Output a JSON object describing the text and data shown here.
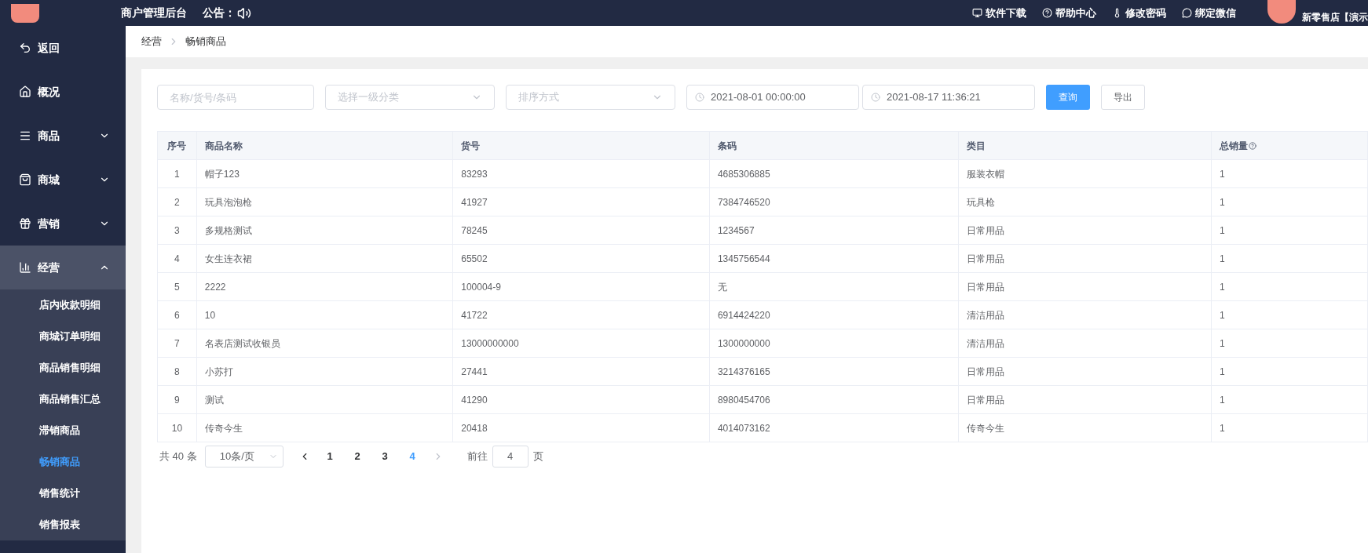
{
  "header": {
    "title": "商户管理后台",
    "notice_label": "公告：",
    "links": [
      {
        "kind": "download",
        "label": "软件下载"
      },
      {
        "kind": "help",
        "label": "帮助中心"
      },
      {
        "kind": "password",
        "label": "修改密码"
      },
      {
        "kind": "wechat",
        "label": "绑定微信"
      }
    ],
    "store_name": "新零售店【演示"
  },
  "sidebar": {
    "items": [
      {
        "kind": "back",
        "label": "返回",
        "selected": false
      },
      {
        "kind": "home",
        "label": "概况",
        "selected": false
      },
      {
        "kind": "list",
        "label": "商品",
        "expandable": true,
        "expanded": false,
        "selected": false
      },
      {
        "kind": "bag",
        "label": "商城",
        "expandable": true,
        "expanded": false,
        "selected": false
      },
      {
        "kind": "gift",
        "label": "营销",
        "expandable": true,
        "expanded": false,
        "selected": false
      },
      {
        "kind": "chart",
        "label": "经营",
        "expandable": true,
        "expanded": true,
        "selected": true,
        "children": [
          {
            "label": "店内收款明细",
            "selected": false
          },
          {
            "label": "商城订单明细",
            "selected": false
          },
          {
            "label": "商品销售明细",
            "selected": false
          },
          {
            "label": "商品销售汇总",
            "selected": false
          },
          {
            "label": "滞销商品",
            "selected": false
          },
          {
            "label": "畅销商品",
            "selected": true
          },
          {
            "label": "销售统计",
            "selected": false
          },
          {
            "label": "销售报表",
            "selected": false
          }
        ]
      }
    ]
  },
  "breadcrumb": [
    "经营",
    "畅销商品"
  ],
  "filters": {
    "search": {
      "placeholder": "名称/货号/条码"
    },
    "category": {
      "placeholder": "选择一级分类"
    },
    "sort": {
      "placeholder": "排序方式"
    },
    "start_time": "2021-08-01 00:00:00",
    "end_time": "2021-08-17 11:36:21",
    "query_button": "查询",
    "export_button": "导出"
  },
  "table": {
    "columns": [
      "序号",
      "商品名称",
      "货号",
      "条码",
      "类目",
      "总销量"
    ],
    "rows": [
      [
        "1",
        "帽子123",
        "83293",
        "4685306885",
        "服装衣帽",
        "1"
      ],
      [
        "2",
        "玩具泡泡枪",
        "41927",
        "7384746520",
        "玩具枪",
        "1"
      ],
      [
        "3",
        "多规格测试",
        "78245",
        "1234567",
        "日常用品",
        "1"
      ],
      [
        "4",
        "女生连衣裙",
        "65502",
        "1345756544",
        "日常用品",
        "1"
      ],
      [
        "5",
        "2222",
        "100004-9",
        "无",
        "日常用品",
        "1"
      ],
      [
        "6",
        "10",
        "41722",
        "6914424220",
        "清洁用品",
        "1"
      ],
      [
        "7",
        "名表店测试收银员",
        "13000000000",
        "1300000000",
        "清洁用品",
        "1"
      ],
      [
        "8",
        "小苏打",
        "27441",
        "3214376165",
        "日常用品",
        "1"
      ],
      [
        "9",
        "测试",
        "41290",
        "8980454706",
        "日常用品",
        "1"
      ],
      [
        "10",
        "传奇今生",
        "20418",
        "4014073162",
        "传奇今生",
        "1"
      ]
    ]
  },
  "pagination": {
    "total": "共 40 条",
    "page_size": "10条/页",
    "pages": [
      {
        "label": "1",
        "selected": false
      },
      {
        "label": "2",
        "selected": false
      },
      {
        "label": "3",
        "selected": false
      },
      {
        "label": "4",
        "selected": true
      }
    ],
    "goto_label": "前往",
    "goto_value": "4",
    "page_suffix": "页"
  }
}
